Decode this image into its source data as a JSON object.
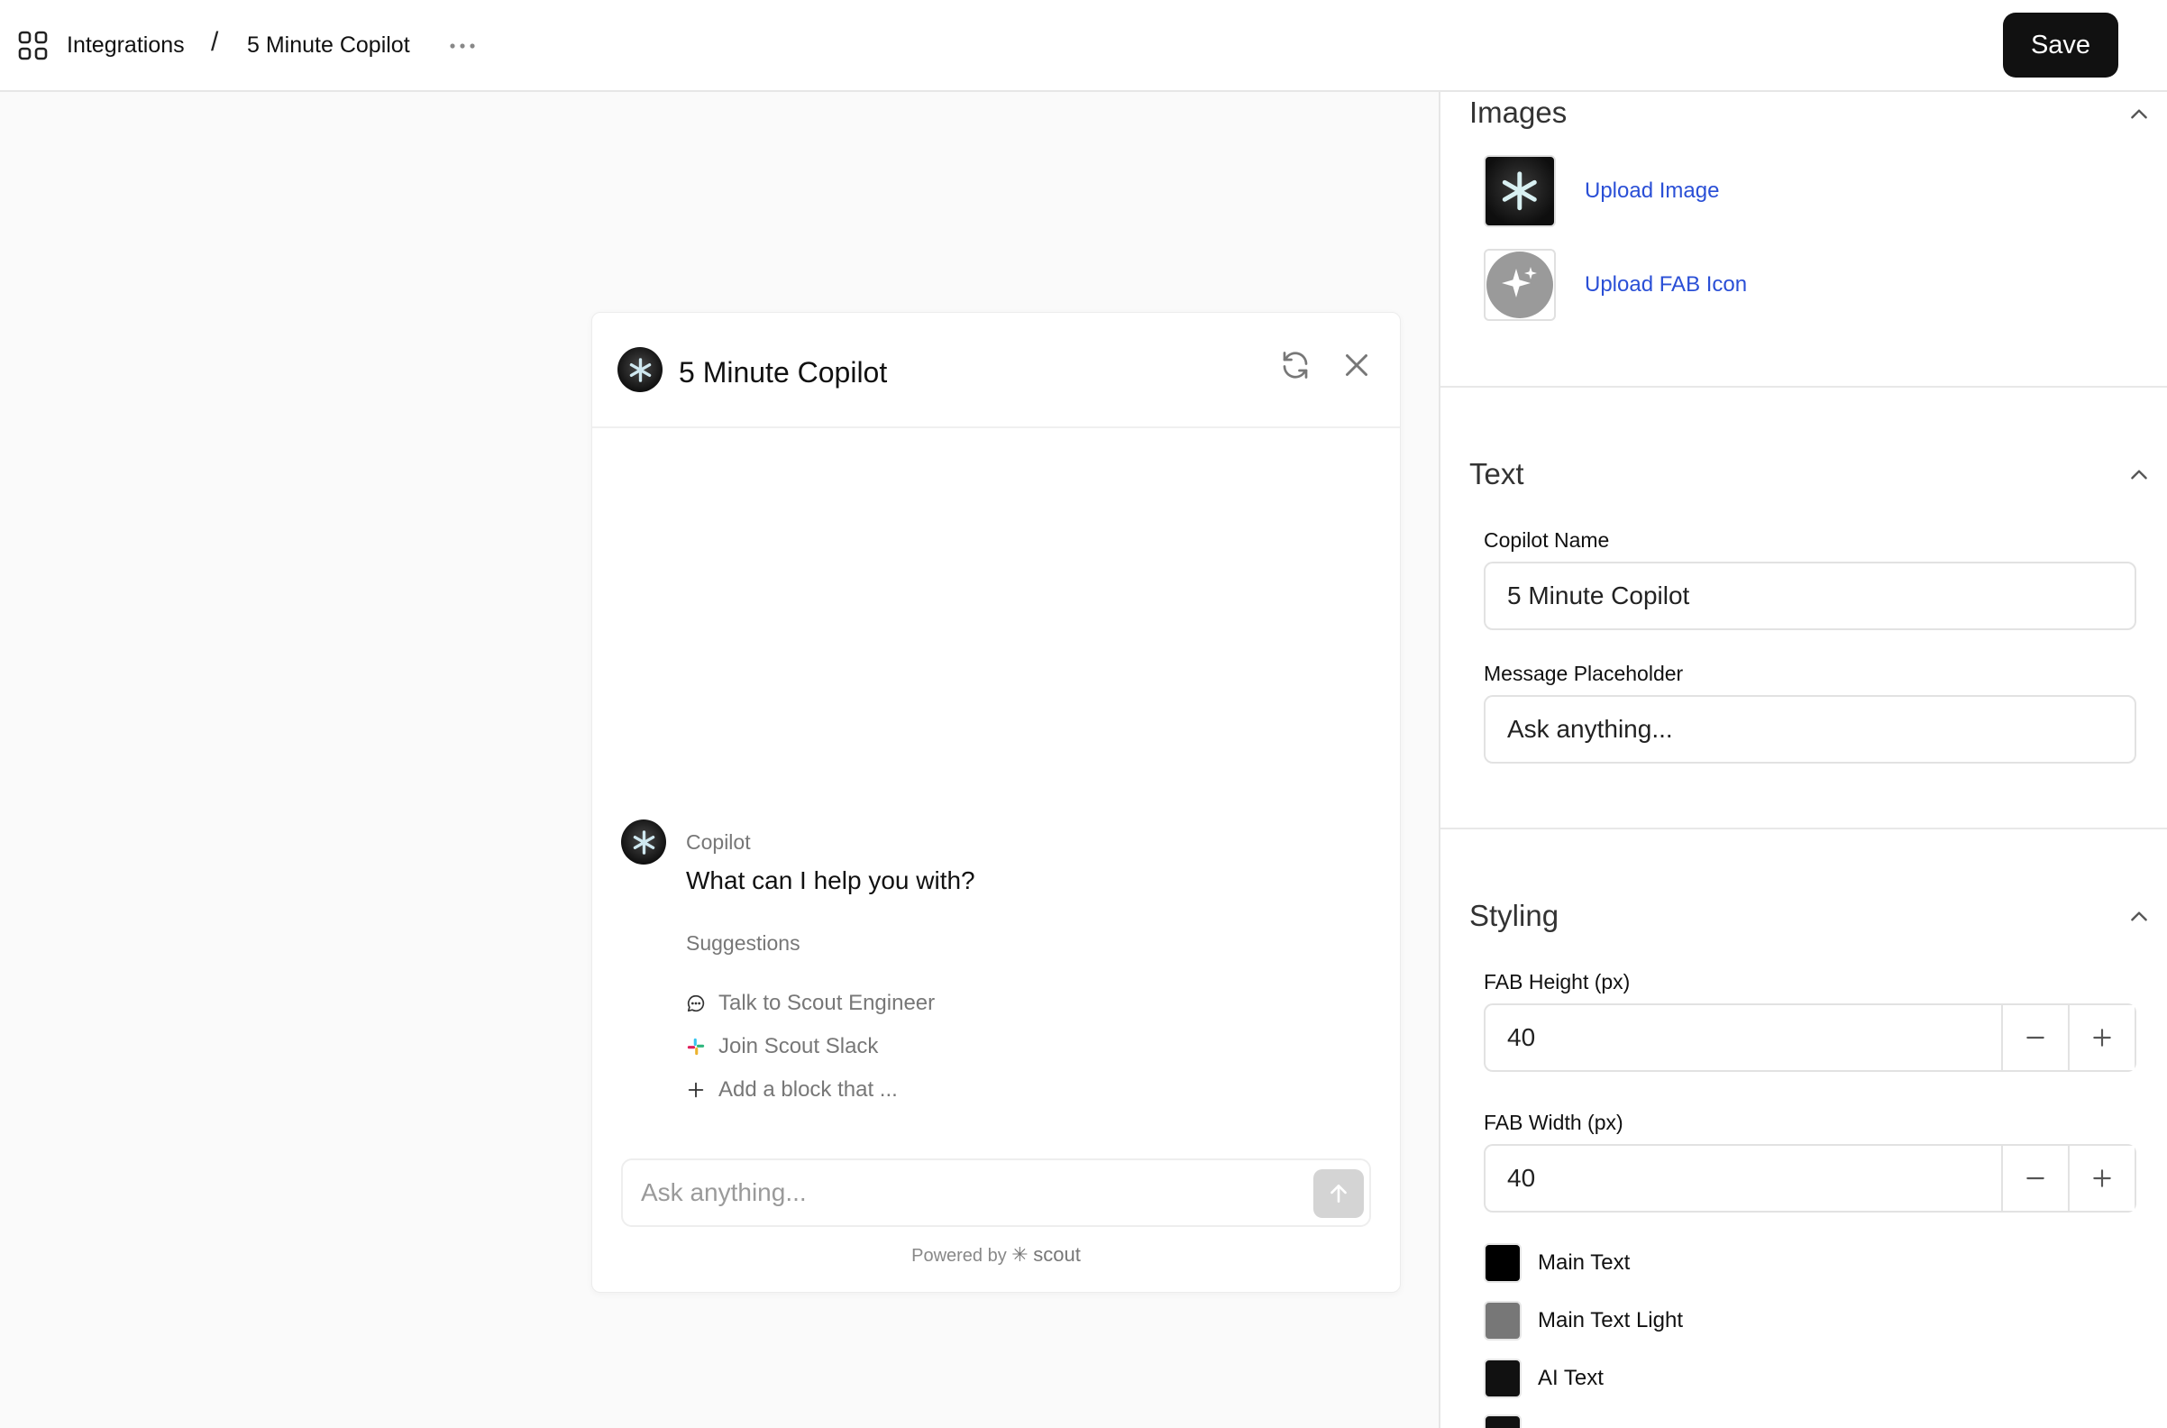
{
  "header": {
    "breadcrumb": {
      "root": "Integrations",
      "separator": "/",
      "current": "5 Minute Copilot"
    },
    "save_label": "Save"
  },
  "preview": {
    "title": "5 Minute Copilot",
    "message": {
      "sender": "Copilot",
      "text": "What can I help you with?"
    },
    "suggestions_title": "Suggestions",
    "suggestions": [
      {
        "label": "Talk to Scout Engineer",
        "icon": "chat-bubble-icon"
      },
      {
        "label": "Join Scout Slack",
        "icon": "slack-icon"
      },
      {
        "label": "Add a block that ...",
        "icon": "plus-icon"
      }
    ],
    "input_placeholder": "Ask anything...",
    "powered_by": "Powered by",
    "powered_brand": "scout"
  },
  "settings": {
    "images": {
      "title": "Images",
      "upload_image": "Upload Image",
      "upload_fab_icon": "Upload FAB Icon"
    },
    "text": {
      "title": "Text",
      "copilot_name_label": "Copilot Name",
      "copilot_name_value": "5 Minute Copilot",
      "message_placeholder_label": "Message Placeholder",
      "message_placeholder_value": "Ask anything..."
    },
    "styling": {
      "title": "Styling",
      "fab_height_label": "FAB Height (px)",
      "fab_height_value": "40",
      "fab_width_label": "FAB Width (px)",
      "fab_width_value": "40",
      "colors": [
        {
          "label": "Main Text",
          "color": "#000000"
        },
        {
          "label": "Main Text Light",
          "color": "#777777"
        },
        {
          "label": "AI Text",
          "color": "#111111"
        },
        {
          "label": "",
          "color": "#111111"
        }
      ]
    }
  },
  "colors": {
    "accent_link": "#2a4fd6",
    "button_dark": "#111111",
    "send_disabled": "#d4d4d4"
  }
}
